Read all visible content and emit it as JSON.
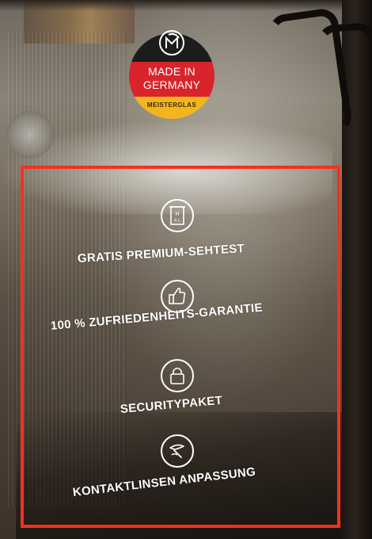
{
  "sticker": {
    "logo_icon": "gm-logo-icon",
    "line1": "MADE IN",
    "line2": "GERMANY",
    "line3": "MEISTERGLAS",
    "colors": {
      "black": "#1c1c1c",
      "red": "#d8242a",
      "gold": "#f2b51e"
    }
  },
  "highlight": {
    "color": "#f2311d"
  },
  "features": [
    {
      "icon": "glasses-test-icon",
      "label": "GRATIS PREMIUM-SEHTEST"
    },
    {
      "icon": "thumbs-up-icon",
      "label": "100 % ZUFRIEDENHEITS-GARANTIE"
    },
    {
      "icon": "padlock-icon",
      "label": "SECURITYPAKET"
    },
    {
      "icon": "contact-lens-icon",
      "label": "KONTAKTLINSEN ANPASSUNG"
    }
  ]
}
